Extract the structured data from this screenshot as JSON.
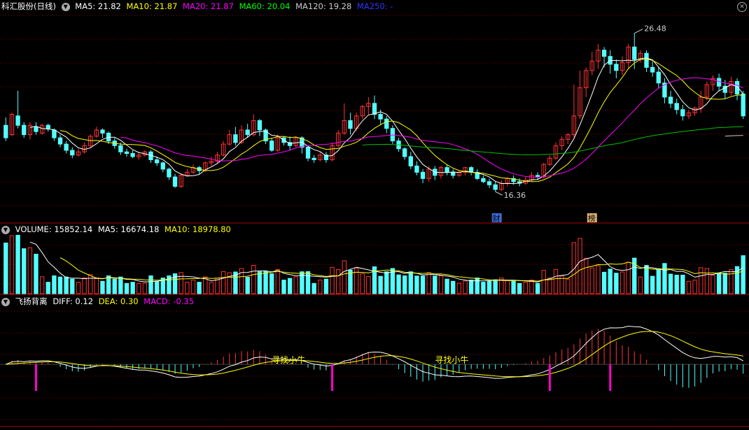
{
  "stock": {
    "title": "科汇股份(日线)"
  },
  "main_legend": [
    {
      "text": "MA5: 21.82",
      "color": "#ffffff"
    },
    {
      "text": "MA10: 21.87",
      "color": "#ffff00"
    },
    {
      "text": "MA20: 21.87",
      "color": "#ff00ff"
    },
    {
      "text": "MA60: 20.04",
      "color": "#00ff00"
    },
    {
      "text": "MA120: 19.28",
      "color": "#cccccc"
    },
    {
      "text": "MA250: -",
      "color": "#3333ff"
    }
  ],
  "volume_legend": [
    {
      "text": "VOLUME: 15852.14",
      "color": "#ffffff"
    },
    {
      "text": "MA5: 16674.18",
      "color": "#ffffff"
    },
    {
      "text": "MA10: 18978.80",
      "color": "#ffff00"
    }
  ],
  "macd_legend": [
    {
      "text": "飞扬背离",
      "color": "#ffffff"
    },
    {
      "text": "DIFF: 0.12",
      "color": "#ffffff"
    },
    {
      "text": "DEA: 0.30",
      "color": "#ffff00"
    },
    {
      "text": "MACD: -0.35",
      "color": "#ff00ff"
    }
  ],
  "icons": {
    "collapse": "chevron-down-icon",
    "close": "close-icon"
  },
  "colors": {
    "up": "#ff3333",
    "down": "#54ffff",
    "grid": "#8b0000",
    "border": "#b00000",
    "ma5": "#ffffff",
    "ma10": "#ffff00",
    "ma20": "#ff00ff",
    "ma60": "#00c000",
    "ma120": "#cccccc",
    "label": "#ffff00",
    "marker": "#ff00cc"
  },
  "chart_data": {
    "type": "candlestick",
    "price_ylim": [
      14.4,
      27.8
    ],
    "highest": 26.48,
    "lowest": 16.36,
    "candles": [
      [
        20.6,
        19.8,
        21.1,
        19.6
      ],
      [
        20.0,
        21.3,
        21.4,
        19.9
      ],
      [
        21.2,
        20.6,
        22.8,
        20.4
      ],
      [
        20.6,
        20.0,
        20.8,
        19.8
      ],
      [
        20.0,
        20.6,
        20.8,
        19.7
      ],
      [
        20.5,
        20.2,
        20.8,
        20.0
      ],
      [
        20.1,
        20.6,
        20.7,
        20.0
      ],
      [
        20.6,
        20.4,
        20.7,
        20.2
      ],
      [
        20.3,
        19.8,
        20.4,
        19.6
      ],
      [
        19.8,
        19.4,
        20.0,
        19.2
      ],
      [
        19.4,
        19.0,
        19.6,
        18.8
      ],
      [
        19.0,
        18.7,
        19.2,
        18.5
      ],
      [
        18.7,
        18.9,
        19.1,
        18.6
      ],
      [
        18.9,
        19.3,
        19.5,
        18.8
      ],
      [
        19.3,
        19.9,
        20.0,
        19.2
      ],
      [
        19.9,
        20.3,
        20.5,
        19.8
      ],
      [
        20.3,
        20.1,
        20.4,
        19.8
      ],
      [
        20.1,
        19.6,
        20.2,
        19.4
      ],
      [
        19.6,
        19.3,
        19.8,
        19.1
      ],
      [
        19.3,
        18.9,
        19.5,
        18.7
      ],
      [
        18.9,
        18.8,
        19.1,
        18.6
      ],
      [
        18.8,
        18.6,
        19.0,
        18.5
      ],
      [
        18.6,
        18.7,
        18.9,
        18.4
      ],
      [
        18.7,
        18.9,
        19.0,
        18.6
      ],
      [
        18.9,
        18.4,
        19.0,
        18.2
      ],
      [
        18.4,
        18.2,
        18.6,
        18.0
      ],
      [
        18.2,
        17.8,
        18.3,
        17.6
      ],
      [
        17.8,
        17.3,
        17.9,
        17.1
      ],
      [
        17.3,
        16.7,
        17.5,
        16.6
      ],
      [
        16.7,
        17.4,
        17.5,
        16.6
      ],
      [
        17.4,
        17.6,
        17.8,
        17.3
      ],
      [
        17.6,
        17.9,
        18.1,
        17.5
      ],
      [
        17.9,
        17.7,
        18.0,
        17.5
      ],
      [
        17.7,
        18.2,
        18.3,
        17.6
      ],
      [
        18.2,
        18.3,
        18.6,
        18.0
      ],
      [
        18.3,
        18.7,
        18.9,
        18.2
      ],
      [
        18.7,
        19.4,
        19.6,
        18.6
      ],
      [
        19.4,
        20.0,
        20.3,
        19.3
      ],
      [
        20.0,
        19.5,
        20.5,
        19.3
      ],
      [
        19.5,
        20.3,
        20.6,
        19.4
      ],
      [
        20.3,
        20.0,
        20.7,
        19.8
      ],
      [
        20.0,
        20.9,
        21.3,
        19.9
      ],
      [
        20.9,
        20.3,
        21.0,
        19.9
      ],
      [
        20.3,
        19.6,
        20.4,
        19.4
      ],
      [
        19.6,
        19.0,
        19.8,
        18.9
      ],
      [
        19.0,
        19.8,
        20.0,
        18.9
      ],
      [
        19.8,
        19.5,
        19.9,
        19.3
      ],
      [
        19.5,
        19.3,
        19.9,
        19.0
      ],
      [
        19.3,
        19.8,
        19.9,
        19.2
      ],
      [
        19.8,
        19.2,
        19.9,
        18.8
      ],
      [
        19.2,
        18.5,
        19.3,
        18.3
      ],
      [
        18.5,
        18.4,
        18.7,
        18.2
      ],
      [
        18.4,
        18.7,
        18.9,
        18.3
      ],
      [
        18.7,
        18.4,
        18.9,
        18.2
      ],
      [
        18.4,
        19.3,
        19.5,
        18.3
      ],
      [
        19.3,
        20.1,
        20.3,
        19.2
      ],
      [
        20.1,
        20.9,
        22.0,
        20.0
      ],
      [
        20.9,
        20.4,
        21.4,
        20.0
      ],
      [
        20.4,
        21.2,
        21.4,
        20.2
      ],
      [
        21.2,
        21.8,
        21.9,
        21.0
      ],
      [
        21.8,
        22.0,
        22.4,
        21.3
      ],
      [
        22.0,
        21.3,
        22.5,
        21.0
      ],
      [
        21.3,
        21.0,
        21.6,
        20.6
      ],
      [
        21.0,
        20.4,
        21.2,
        20.1
      ],
      [
        20.4,
        19.6,
        20.6,
        19.4
      ],
      [
        19.6,
        19.1,
        19.8,
        18.9
      ],
      [
        19.1,
        18.6,
        19.2,
        18.4
      ],
      [
        18.6,
        18.0,
        18.9,
        17.8
      ],
      [
        18.0,
        17.6,
        18.3,
        17.4
      ],
      [
        17.6,
        17.2,
        17.8,
        16.9
      ],
      [
        17.2,
        17.8,
        18.0,
        17.0
      ],
      [
        17.8,
        17.4,
        18.0,
        17.1
      ],
      [
        17.4,
        17.9,
        18.0,
        17.2
      ],
      [
        17.9,
        17.6,
        18.1,
        17.4
      ],
      [
        17.6,
        17.4,
        17.8,
        17.2
      ],
      [
        17.4,
        17.6,
        17.7,
        17.3
      ],
      [
        17.6,
        17.9,
        17.9,
        17.4
      ],
      [
        17.9,
        17.6,
        18.0,
        17.4
      ],
      [
        17.6,
        17.2,
        17.8,
        17.1
      ],
      [
        17.2,
        17.0,
        17.4,
        16.9
      ],
      [
        17.0,
        16.8,
        17.2,
        16.6
      ],
      [
        16.8,
        16.5,
        17.0,
        16.36
      ],
      [
        16.5,
        16.9,
        17.1,
        16.4
      ],
      [
        16.9,
        17.2,
        17.3,
        16.7
      ],
      [
        17.2,
        17.0,
        17.4,
        16.8
      ],
      [
        17.0,
        16.9,
        17.2,
        16.7
      ],
      [
        16.9,
        17.1,
        17.3,
        16.8
      ],
      [
        17.1,
        17.4,
        17.6,
        17.0
      ],
      [
        17.4,
        17.3,
        17.6,
        17.1
      ],
      [
        17.3,
        18.1,
        18.2,
        17.2
      ],
      [
        18.1,
        18.5,
        18.7,
        18.0
      ],
      [
        18.5,
        19.3,
        19.5,
        18.4
      ],
      [
        19.3,
        19.7,
        19.9,
        19.0
      ],
      [
        19.7,
        20.0,
        20.1,
        19.4
      ],
      [
        20.0,
        21.2,
        23.2,
        19.8
      ],
      [
        21.2,
        23.0,
        24.1,
        21.0
      ],
      [
        23.0,
        24.1,
        24.3,
        22.4
      ],
      [
        24.1,
        24.7,
        25.3,
        23.8
      ],
      [
        24.7,
        25.4,
        25.8,
        24.2
      ],
      [
        25.4,
        25.0,
        25.6,
        24.3
      ],
      [
        25.0,
        24.5,
        25.4,
        23.9
      ],
      [
        24.5,
        24.1,
        24.8,
        23.6
      ],
      [
        24.1,
        24.6,
        25.0,
        23.8
      ],
      [
        24.6,
        25.6,
        25.8,
        24.2
      ],
      [
        25.6,
        24.8,
        26.48,
        24.2
      ],
      [
        24.8,
        25.2,
        25.4,
        24.6
      ],
      [
        25.2,
        24.3,
        25.4,
        24.0
      ],
      [
        24.3,
        24.0,
        24.7,
        23.7
      ],
      [
        24.0,
        23.3,
        24.3,
        23.0
      ],
      [
        23.3,
        22.4,
        23.6,
        22.0
      ],
      [
        22.4,
        22.0,
        22.8,
        21.7
      ],
      [
        22.0,
        21.6,
        22.3,
        21.3
      ],
      [
        21.6,
        21.2,
        21.9,
        20.9
      ],
      [
        21.2,
        21.4,
        21.6,
        21.0
      ],
      [
        21.4,
        21.7,
        21.8,
        21.2
      ],
      [
        21.7,
        22.4,
        22.8,
        21.4
      ],
      [
        22.4,
        23.2,
        23.4,
        22.2
      ],
      [
        23.2,
        23.6,
        23.8,
        22.8
      ],
      [
        23.6,
        23.1,
        23.9,
        22.8
      ],
      [
        23.1,
        22.7,
        23.5,
        22.3
      ],
      [
        22.7,
        23.4,
        23.7,
        22.5
      ],
      [
        23.4,
        22.6,
        23.6,
        22.2
      ],
      [
        22.6,
        21.2,
        22.8,
        21.0
      ]
    ],
    "ma_settings": [
      5,
      10,
      20,
      60,
      120
    ],
    "annotations": [
      {
        "label": "26.48",
        "type": "high"
      },
      {
        "label": "16.36",
        "type": "low"
      },
      {
        "label": "财",
        "type": "tag"
      },
      {
        "label": "榜",
        "type": "tag"
      }
    ],
    "volume_ylim": [
      0,
      110
    ],
    "macd_ylim": [
      -3.0,
      2.8
    ],
    "macd_labels": [
      "寻找小牛",
      "寻找小牛"
    ]
  }
}
